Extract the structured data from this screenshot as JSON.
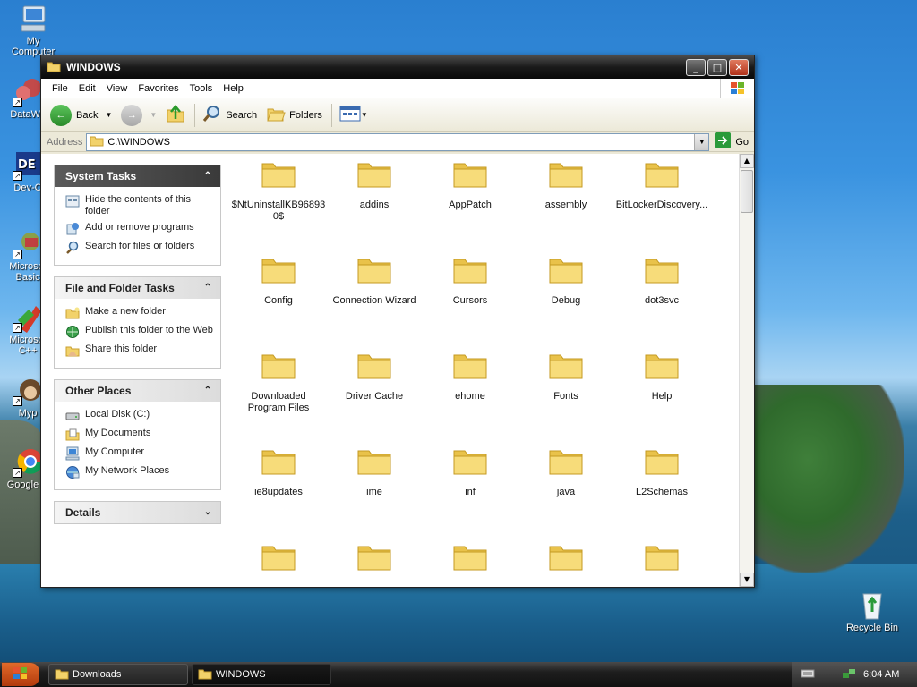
{
  "desktop": {
    "icons": [
      {
        "label": "My Computer"
      },
      {
        "label": "DataWa"
      },
      {
        "label": "Dev-C"
      },
      {
        "label": "Microsof Basic"
      },
      {
        "label": "Microsof C++"
      },
      {
        "label": "Myp"
      },
      {
        "label": "Google C"
      },
      {
        "label": "Recycle Bin"
      }
    ]
  },
  "window": {
    "title": "WINDOWS",
    "menu": [
      "File",
      "Edit",
      "View",
      "Favorites",
      "Tools",
      "Help"
    ],
    "toolbar": {
      "back": "Back",
      "search": "Search",
      "folders": "Folders"
    },
    "address": {
      "label": "Address",
      "value": "C:\\WINDOWS",
      "go": "Go"
    },
    "taskpane": {
      "system_tasks": {
        "title": "System Tasks",
        "items": [
          "Hide the contents of this folder",
          "Add or remove programs",
          "Search for files or folders"
        ]
      },
      "file_folder_tasks": {
        "title": "File and Folder Tasks",
        "items": [
          "Make a new folder",
          "Publish this folder to the Web",
          "Share this folder"
        ]
      },
      "other_places": {
        "title": "Other Places",
        "items": [
          "Local Disk (C:)",
          "My Documents",
          "My Computer",
          "My Network Places"
        ]
      },
      "details": {
        "title": "Details"
      }
    },
    "files": [
      "$NtUninstallKB96893 0$",
      "addins",
      "AppPatch",
      "assembly",
      "BitLockerDiscovery...",
      "Config",
      "Connection Wizard",
      "Cursors",
      "Debug",
      "dot3svc",
      "Downloaded Program Files",
      "Driver Cache",
      "ehome",
      "Fonts",
      "Help",
      "ie8updates",
      "ime",
      "inf",
      "java",
      "L2Schemas",
      "",
      "",
      "",
      "",
      ""
    ]
  },
  "taskbar": {
    "tasks": [
      "Downloads",
      "WINDOWS"
    ],
    "clock": "6:04 AM"
  }
}
